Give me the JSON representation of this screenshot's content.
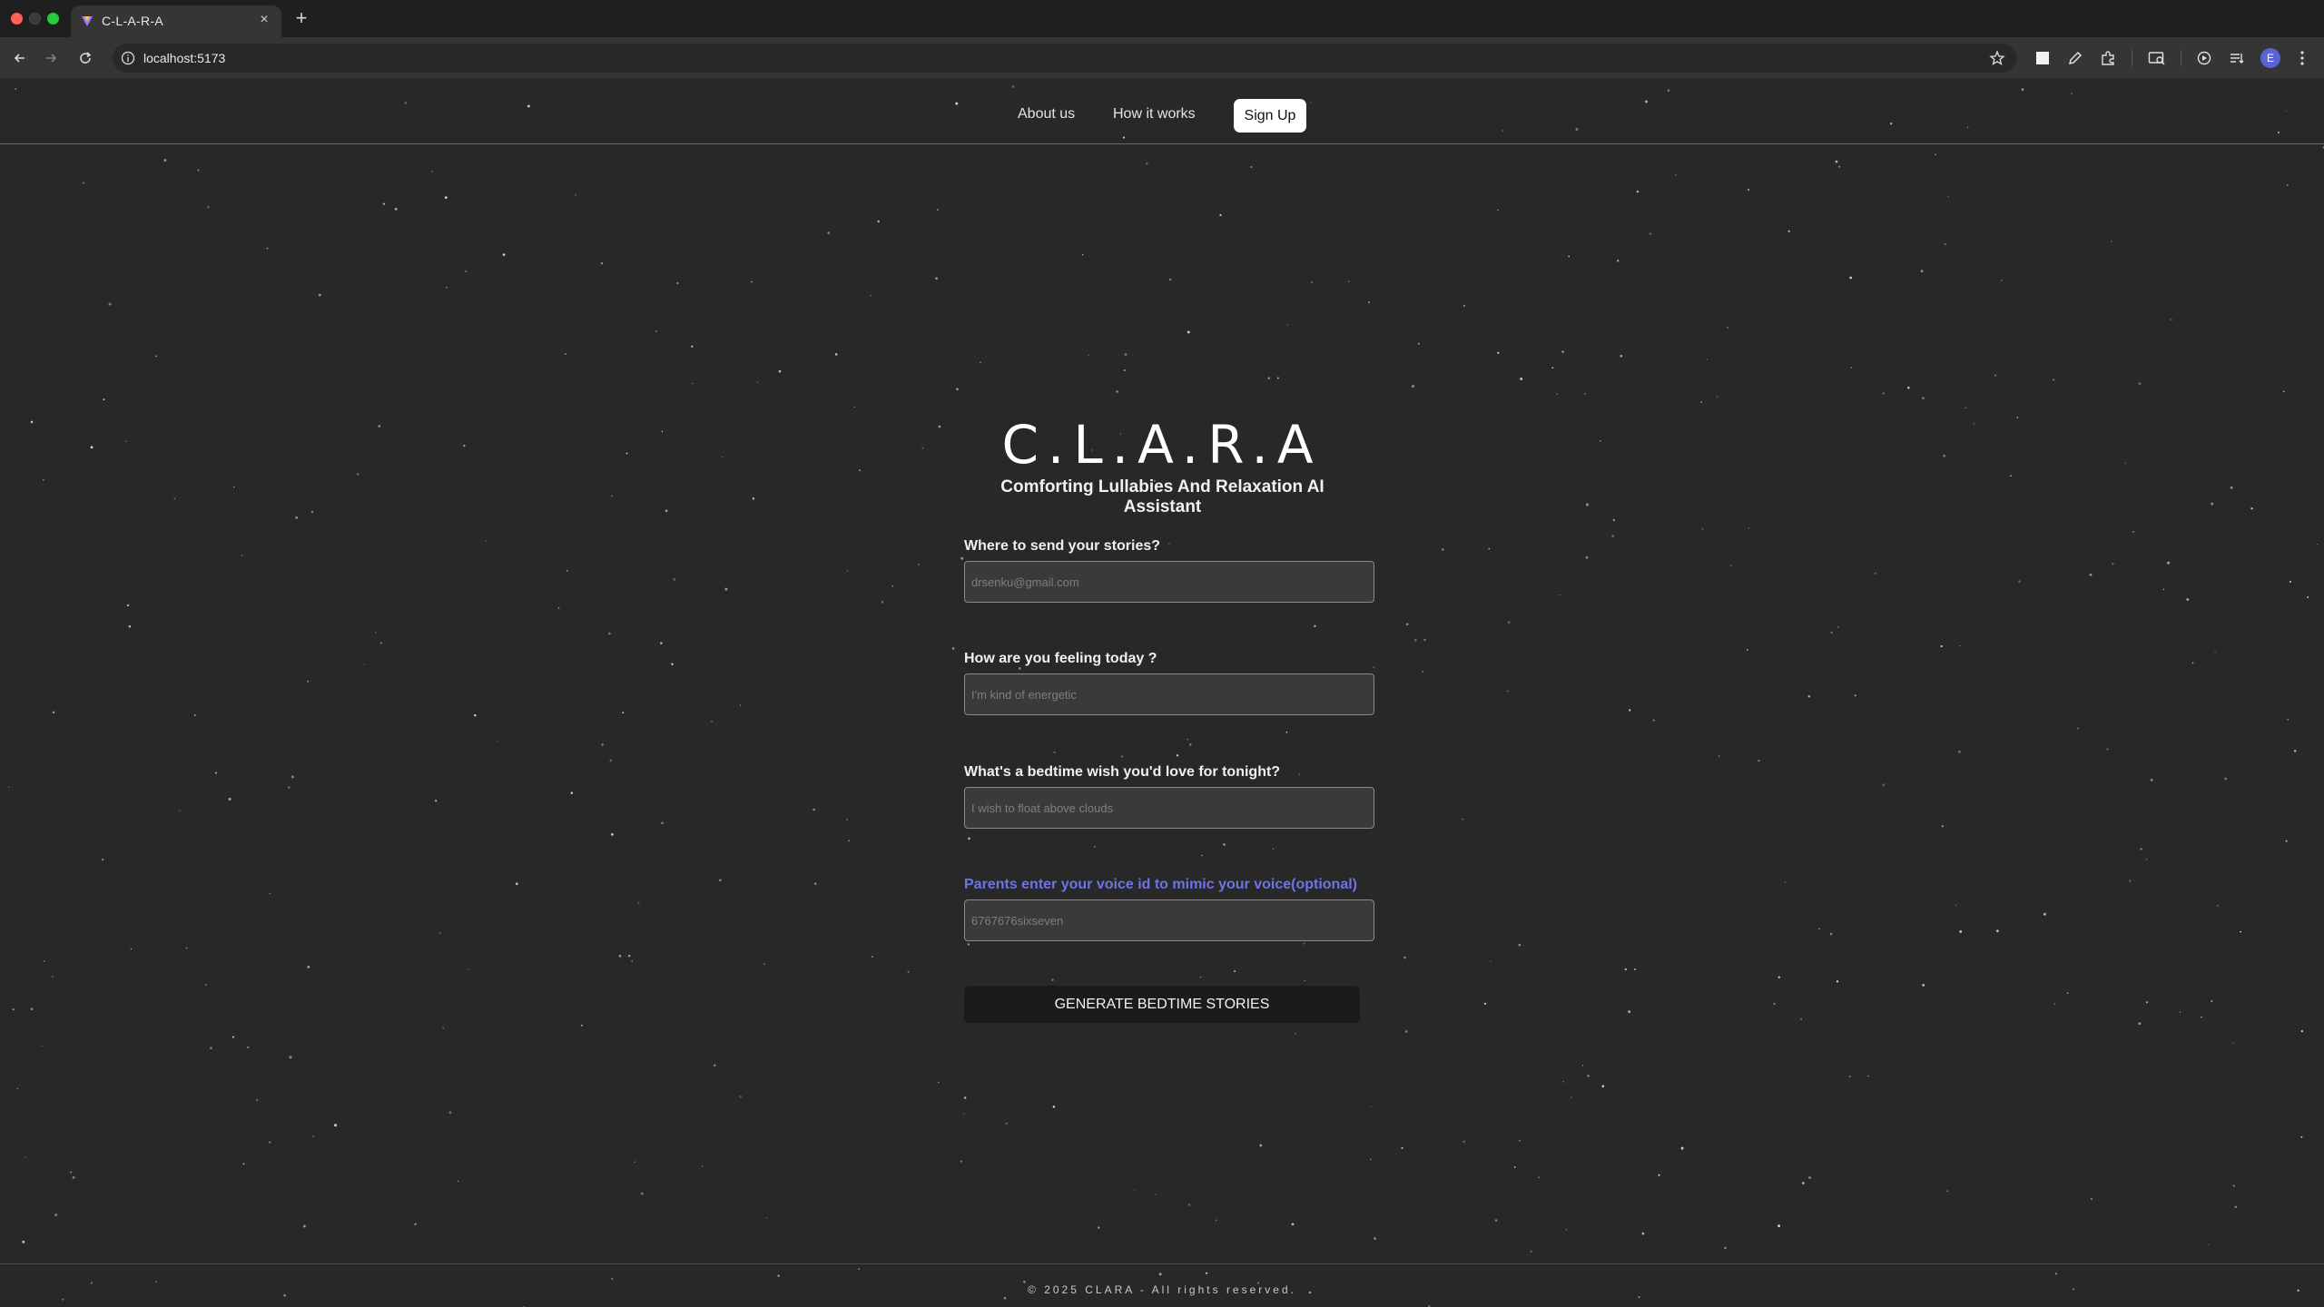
{
  "browser": {
    "tab_title": "C-L-A-R-A",
    "url": "localhost:5173",
    "profile_initial": "E"
  },
  "nav": {
    "about": "About us",
    "how": "How it works",
    "signup": "Sign Up"
  },
  "hero": {
    "title": "C.L.A.R.A",
    "subtitle": "Comforting Lullabies And Relaxation AI Assistant"
  },
  "form": {
    "email_label": "Where to send your stories?",
    "email_placeholder": "drsenku@gmail.com",
    "feeling_label": "How are you feeling today ?",
    "feeling_placeholder": "I'm kind of energetic",
    "wish_label": "What's a bedtime wish you'd love for tonight?",
    "wish_placeholder": "I wish to float above clouds",
    "voice_label": "Parents enter your voice id to mimic your voice(optional)",
    "voice_placeholder": "6767676sixseven",
    "submit": "GENERATE BEDTIME STORIES"
  },
  "footer": {
    "text": "© 2025 CLARA - All rights reserved."
  },
  "colors": {
    "background": "#282828",
    "accent": "#6e73e6",
    "button_dark": "#1b1b1b"
  }
}
